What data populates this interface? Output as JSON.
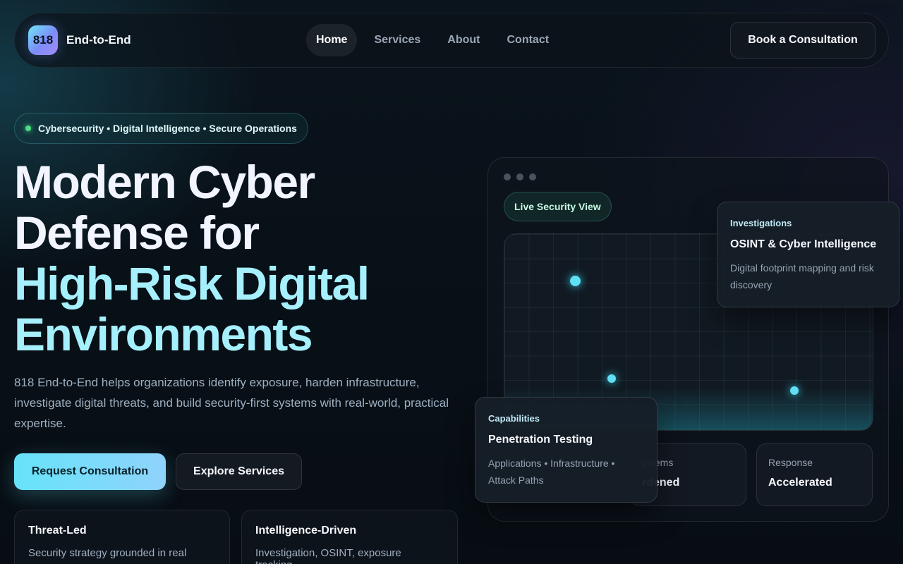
{
  "nav": {
    "logo_text": "818",
    "brand": "End-to-End",
    "links": [
      {
        "label": "Home"
      },
      {
        "label": "Services"
      },
      {
        "label": "About"
      },
      {
        "label": "Contact"
      }
    ],
    "active_link": "Home",
    "cta": "Book a Consultation"
  },
  "hero": {
    "tagline": "Cybersecurity • Digital Intelligence • Secure Operations",
    "headline_line1": "Modern Cyber",
    "headline_line2": "Defense for",
    "headline_line3": "High-Risk Digital",
    "headline_line4": "Environments",
    "lead": "818 End-to-End helps organizations identify exposure, harden infrastructure, investigate digital threats, and build security-first systems with real-world, practical expertise.",
    "primary_button": "Request Consultation",
    "secondary_button": "Explore Services"
  },
  "features": [
    {
      "title": "Threat-Led",
      "text": "Security strategy grounded in real"
    },
    {
      "title": "Intelligence-Driven",
      "text": "Investigation, OSINT, exposure tracking,"
    }
  ],
  "panel": {
    "badge": "Live Security View",
    "stats": [
      {
        "label": "ystems",
        "value": "rdened"
      },
      {
        "label": "Response",
        "value": "Accelerated"
      }
    ],
    "card_investigations": {
      "category": "Investigations",
      "title": "OSINT & Cyber Intelligence",
      "description": "Digital footprint mapping and risk discovery"
    },
    "card_capabilities": {
      "category": "Capabilities",
      "title": "Penetration Testing",
      "description": "Applications • Infrastructure • Attack Paths"
    }
  },
  "colors": {
    "accent": "#67e3f9",
    "headline_accent": "#a5f0fc",
    "status_dot": "#4ade80",
    "background": "#070d13"
  }
}
